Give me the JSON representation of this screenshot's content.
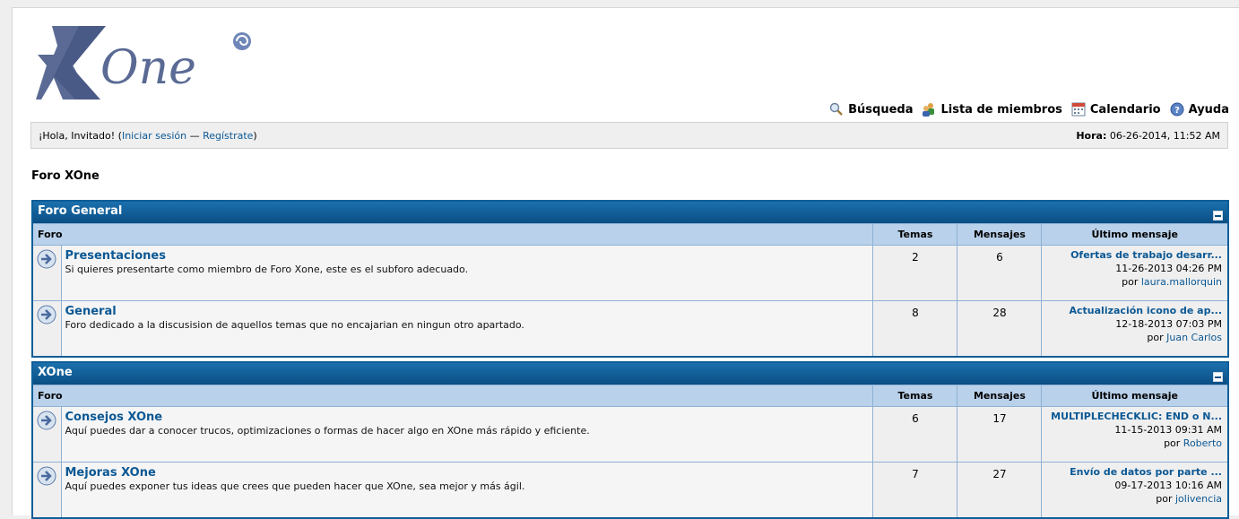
{
  "logo": {
    "text": "One",
    "letter": "X"
  },
  "toplinks": [
    {
      "label": "Búsqueda",
      "icon": "search-icon"
    },
    {
      "label": "Lista de miembros",
      "icon": "members-icon"
    },
    {
      "label": "Calendario",
      "icon": "calendar-icon"
    },
    {
      "label": "Ayuda",
      "icon": "help-icon"
    }
  ],
  "welcome": {
    "greeting": "¡Hola, Invitado! (",
    "login": "Iniciar sesión",
    "sep": " — ",
    "register": "Regístrate",
    "close": ")",
    "time_label": "Hora:",
    "time_value": " 06-26-2014, 11:52 AM"
  },
  "nav_title": "Foro XOne",
  "headers": {
    "forum": "Foro",
    "topics": "Temas",
    "posts": "Mensajes",
    "last": "Último mensaje"
  },
  "categories": [
    {
      "title": "Foro General",
      "forums": [
        {
          "name": "Presentaciones",
          "desc": "Si quieres presentarte como miembro de Foro Xone, este es el subforo adecuado.",
          "topics": "2",
          "posts": "6",
          "last_title": "Ofertas de trabajo desarr...",
          "last_date": "11-26-2013 04:26 PM",
          "last_by": "por ",
          "last_user": "laura.mallorquin"
        },
        {
          "name": "General",
          "desc": "Foro dedicado a la discusision de aquellos temas que no encajarian en ningun otro apartado.",
          "topics": "8",
          "posts": "28",
          "last_title": "Actualización icono de ap...",
          "last_date": "12-18-2013 07:03 PM",
          "last_by": "por ",
          "last_user": "Juan Carlos"
        }
      ]
    },
    {
      "title": "XOne",
      "forums": [
        {
          "name": "Consejos XOne",
          "desc": "Aquí puedes dar a conocer trucos, optimizaciones o formas de hacer algo en XOne más rápido y eficiente.",
          "topics": "6",
          "posts": "17",
          "last_title": "MULTIPLECHECKLIC: END o N...",
          "last_date": "11-15-2013 09:31 AM",
          "last_by": "por ",
          "last_user": "Roberto"
        },
        {
          "name": "Mejoras XOne",
          "desc": "Aquí puedes exponer tus ideas que crees que pueden hacer que XOne, sea mejor y más ágil.",
          "topics": "7",
          "posts": "27",
          "last_title": "Envío de datos por parte ...",
          "last_date": "09-17-2013 10:16 AM",
          "last_by": "por ",
          "last_user": "jolivencia"
        }
      ]
    }
  ]
}
